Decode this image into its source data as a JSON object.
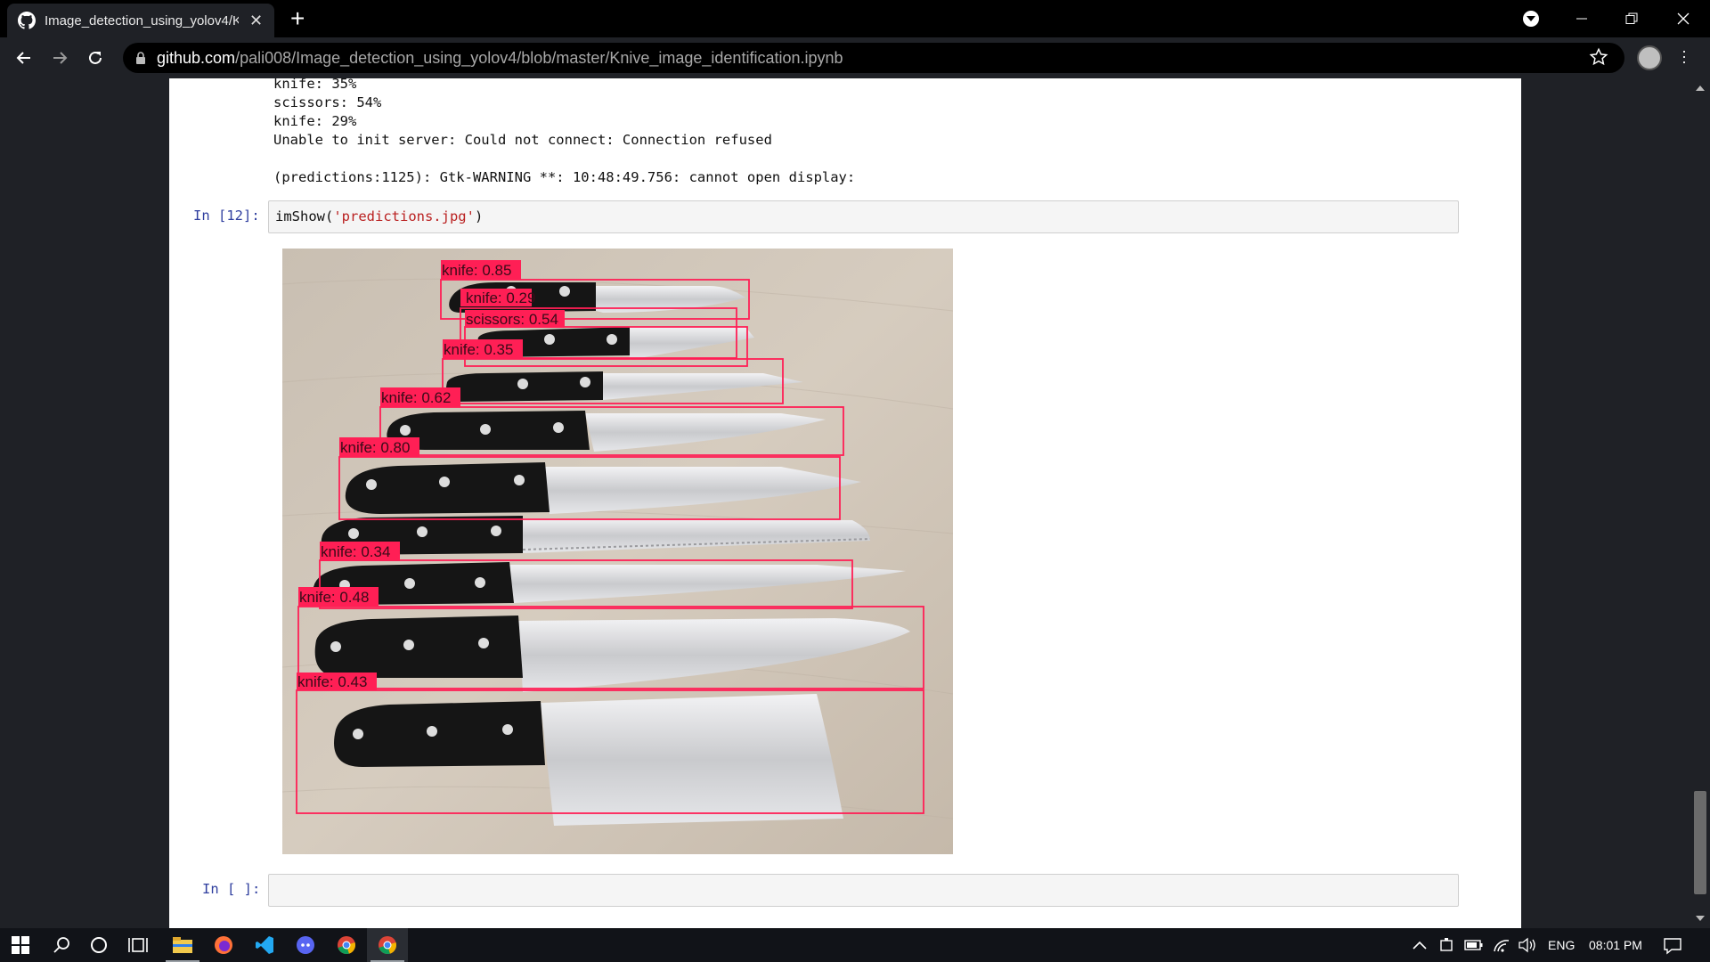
{
  "browser": {
    "tab_title": "Image_detection_using_yolov4/Knive_image_identification.ipynb",
    "url_host": "github.com",
    "url_path": "/pali008/Image_detection_using_yolov4/blob/master/Knive_image_identification.ipynb",
    "icons": {
      "github": "github-logo-icon",
      "close": "close-icon",
      "new_tab": "plus-icon",
      "back": "arrow-left-icon",
      "forward": "arrow-right-icon",
      "reload": "reload-icon",
      "lock": "lock-icon",
      "bookmark": "star-icon",
      "menu": "kebab-menu-icon",
      "downloads": "download-badge-icon"
    }
  },
  "notebook": {
    "output_lines": [
      "knife: 35%",
      "scissors: 54%",
      "knife: 29%",
      "Unable to init server: Could not connect: Connection refused",
      "",
      "(predictions:1125): Gtk-WARNING **: 10:48:49.756: cannot open display:"
    ],
    "cell1_prompt": "In [12]:",
    "cell1_code_fn": "imShow(",
    "cell1_code_arg": "'predictions.jpg'",
    "cell1_code_end": ")",
    "cell2_prompt": "In [ ]:",
    "detections": [
      "knife: 0.85",
      "knife: 0.29",
      "scissors: 0.54",
      "knife: 0.35",
      "knife: 0.62",
      "knife: 0.80",
      "knife: 0.34",
      "knife: 0.48",
      "knife: 0.43"
    ],
    "box_color": "#ff1f55"
  },
  "taskbar": {
    "apps": [
      "windows-start-icon",
      "search-icon",
      "cortana-icon",
      "task-view-icon",
      "file-explorer-icon",
      "firefox-icon",
      "vscode-icon",
      "discord-icon",
      "chrome-icon",
      "chrome-active-icon"
    ],
    "language": "ENG",
    "time": "08:01 PM"
  }
}
